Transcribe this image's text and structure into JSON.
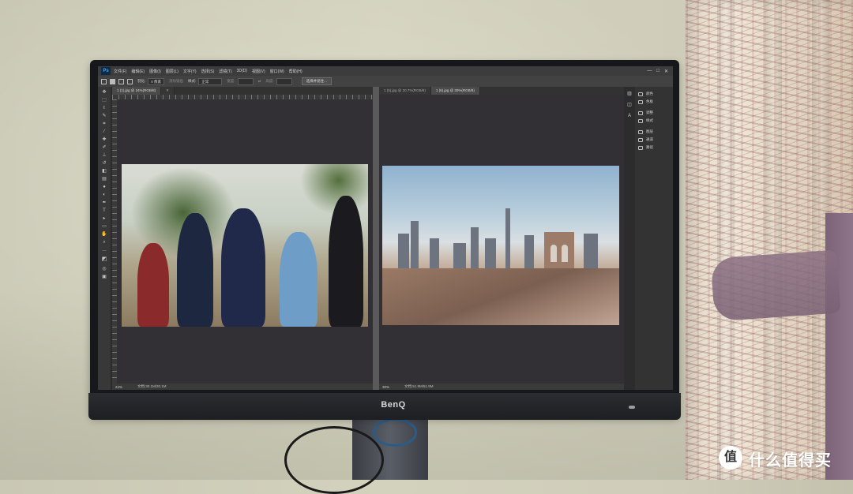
{
  "monitor": {
    "brand": "BenQ"
  },
  "photoshop": {
    "logo": "Ps",
    "menu": [
      "文件(F)",
      "编辑(E)",
      "图像(I)",
      "图层(L)",
      "文字(Y)",
      "选择(S)",
      "滤镜(T)",
      "3D(D)",
      "视图(V)",
      "窗口(W)",
      "帮助(H)"
    ],
    "window_controls": [
      "—",
      "□",
      "✕"
    ],
    "options_bar": {
      "feather_label": "羽化:",
      "feather_value": "0 像素",
      "antialias_label": "消除锯齿",
      "style_label": "样式:",
      "style_value": "正常",
      "width_label": "宽度:",
      "height_label": "高度:",
      "select_mask_button": "选择并遮住..."
    },
    "tools": [
      "move-icon",
      "marquee-icon",
      "lasso-icon",
      "quick-select-icon",
      "crop-icon",
      "eyedropper-icon",
      "healing-icon",
      "brush-icon",
      "stamp-icon",
      "history-brush-icon",
      "eraser-icon",
      "gradient-icon",
      "blur-icon",
      "dodge-icon",
      "pen-icon",
      "type-icon",
      "path-select-icon",
      "rectangle-icon",
      "hand-icon",
      "zoom-icon",
      "more-icon",
      "colors-icon",
      "quick-mask-icon",
      "screen-mode-icon"
    ],
    "left_document": {
      "tab": "1 (1).jpg @ 24%(RGB/8)",
      "status_zoom": "24%",
      "status_info": "文档:30.1M/30.1M"
    },
    "right_document": {
      "tabs": [
        "1 (5).jpg @ 20.7%(RGB/8)",
        "1 (6).jpg @ 30%(RGB/8)"
      ],
      "status_zoom": "30%",
      "status_info": "文档:51.9M/51.9M"
    },
    "panels": [
      "颜色",
      "色板",
      "调整",
      "样式",
      "图层",
      "通道",
      "路径"
    ],
    "panel_icons": [
      "palette-icon",
      "swatches-icon",
      "adjustments-icon",
      "styles-icon",
      "layers-icon",
      "channels-icon",
      "paths-icon"
    ]
  },
  "watermark": {
    "logo_glyph": "值",
    "text": "什么值得买"
  }
}
